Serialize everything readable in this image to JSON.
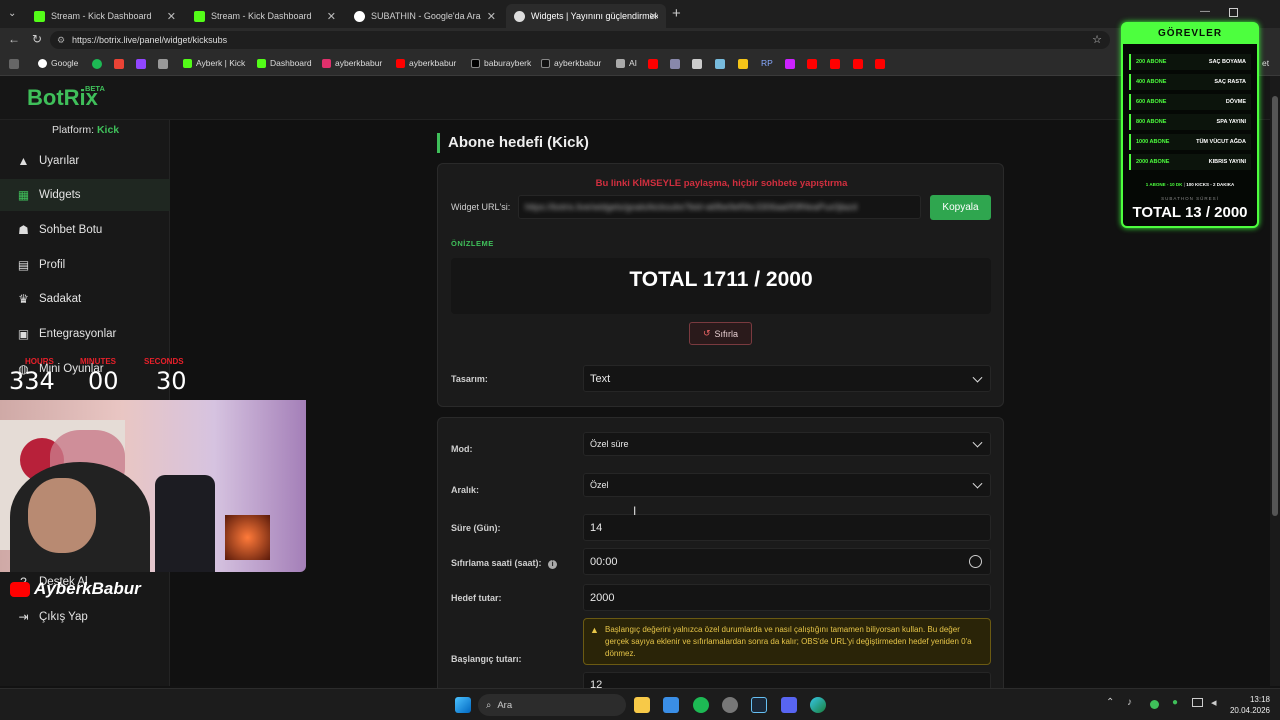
{
  "browser": {
    "tabs": [
      {
        "title": "Stream - Kick Dashboard",
        "color": "#53fc18"
      },
      {
        "title": "Stream - Kick Dashboard",
        "color": "#53fc18"
      },
      {
        "title": "SUBATHIN - Google'da Ara",
        "color": "#4285f4"
      },
      {
        "title": "Widgets | Yayınını güçlendirmek iç",
        "color": "#dddddd"
      }
    ],
    "url": "https://botrix.live/panel/widget/kicksubs",
    "bookmarks": [
      "Google",
      "Ayberk | Kick",
      "Dashboard",
      "ayberkbabur",
      "ayberkbabur",
      "baburayberk",
      "ayberkbabur",
      "AI",
      "RP"
    ],
    "bookmark_overflow": "et"
  },
  "brand": {
    "name": "BotRix",
    "badge": "BETA",
    "accent": "#3fbf5a"
  },
  "sidebar": {
    "platform_label": "Platform:",
    "platform_value": "Kick",
    "items": [
      {
        "label": "Uyarılar",
        "icon": "warning-icon"
      },
      {
        "label": "Widgets",
        "icon": "grid-icon"
      },
      {
        "label": "Sohbet Botu",
        "icon": "robot-icon"
      },
      {
        "label": "Profil",
        "icon": "id-card-icon"
      },
      {
        "label": "Sadakat",
        "icon": "trophy-icon"
      },
      {
        "label": "Entegrasyonlar",
        "icon": "integration-icon"
      },
      {
        "label": "Mini Oyunlar",
        "icon": "gamepad-icon"
      },
      {
        "label": "Destek Al",
        "icon": "support-icon"
      },
      {
        "label": "Çıkış Yap",
        "icon": "logout-icon"
      }
    ]
  },
  "main": {
    "title": "Abone hedefi (Kick)",
    "warning": "Bu linki KİMSEYLE paylaşma, hiçbir sohbete yapıştırma",
    "widget_url_label": "Widget URL'si:",
    "widget_url_value": "https://botrix.live/widgets/goals/kicksubs?bid=a6fbe9ef0bc3306aa0f3ff4eaPux0jlazd",
    "copy_button": "Kopyala",
    "preview_label": "ÖNİZLEME",
    "preview_text": "TOTAL 1711 / 2000",
    "reset_button": "Sıfırla",
    "design_label": "Tasarım:",
    "design_value": "Text",
    "mode_label": "Mod:",
    "mode_value": "Özel süre",
    "range_label": "Aralık:",
    "range_value": "Özel",
    "duration_label": "Süre (Gün):",
    "duration_value": "14",
    "reset_time_label": "Sıfırlama saati (saat):",
    "reset_time_value": "00:00",
    "target_label": "Hedef tutar:",
    "target_value": "2000",
    "start_label": "Başlangıç tutarı:",
    "start_warning": "Başlangıç değerini yalnızca özel durumlarda ve nasıl çalıştığını tamamen biliyorsan kullan. Bu değer gerçek sayıya eklenir ve sıfırlamalardan sonra da kalır; OBS'de URL'yi değiştirmeden hedef yeniden 0'a dönmez.",
    "start_value": "12"
  },
  "goals_overlay": {
    "title": "GÖREVLER",
    "rows": [
      {
        "count": "200 ABONE",
        "task": "SAÇ BOYAMA"
      },
      {
        "count": "400 ABONE",
        "task": "SAÇ RASTA"
      },
      {
        "count": "600 ABONE",
        "task": "DÖVME"
      },
      {
        "count": "800 ABONE",
        "task": "SPA YAYINI"
      },
      {
        "count": "1000 ABONE",
        "task": "TÜM VÜCUT AĞDA"
      },
      {
        "count": "2000 ABONE",
        "task": "KIBRIS YAYINI"
      }
    ],
    "footer_a": "1 ABONE - 10 DK",
    "footer_b": "100 KICKS - 2 DAKIKA",
    "sub_label": "SUBATHON SÜRESİ",
    "total": "TOTAL 13 / 2000"
  },
  "timer_overlay": {
    "hours_label": "HOURS",
    "minutes_label": "MINUTES",
    "seconds_label": "SECONDS",
    "hours": "334",
    "minutes": "00",
    "seconds": "30"
  },
  "streamer": {
    "name": "AyberkBabur"
  },
  "taskbar": {
    "search": "Ara",
    "time": "13:18",
    "date": "20.04.2026"
  }
}
